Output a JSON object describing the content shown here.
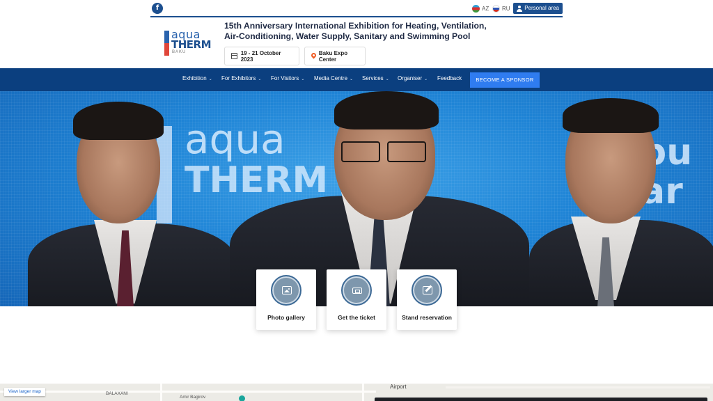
{
  "topbar": {
    "facebook_icon": "facebook-icon",
    "languages": [
      {
        "code": "AZ",
        "flag": "az-flag-icon"
      },
      {
        "code": "RU",
        "flag": "ru-flag-icon"
      }
    ],
    "personal_area_label": "Personal area"
  },
  "header": {
    "logo": {
      "line1": "aqua",
      "line2": "THERM",
      "line3": "BAKU"
    },
    "title_line1": "15th Anniversary International Exhibition for Heating, Ventilation,",
    "title_line2": "Air-Conditioning, Water Supply, Sanitary and Swimming Pool",
    "dates": "19 - 21 October 2023",
    "venue": "Baku Expo Center"
  },
  "nav": {
    "items": [
      {
        "label": "Exhibition",
        "caret": "⌄"
      },
      {
        "label": "For Exhibitors",
        "caret": "⌄"
      },
      {
        "label": "For Visitors",
        "caret": "⌄"
      },
      {
        "label": "Media Centre",
        "caret": "⌄"
      },
      {
        "label": "Services",
        "caret": "⌄"
      },
      {
        "label": "Organiser",
        "caret": "⌄"
      },
      {
        "label": "Feedback",
        "caret": ""
      }
    ],
    "sponsor_button": "BECOME A SPONSOR"
  },
  "hero": {
    "backdrop_text_1": "aqua",
    "backdrop_text_2": "THERM",
    "backdrop_text_right": "bu\nar"
  },
  "cards": [
    {
      "label": "Photo gallery",
      "icon": "image-icon"
    },
    {
      "label": "Get the ticket",
      "icon": "ticket-icon"
    },
    {
      "label": "Stand reservation",
      "icon": "edit-icon"
    }
  ],
  "map": {
    "view_larger_label": "View larger map",
    "labels": [
      "BALAXANI",
      "Amir Bagirov",
      "Airport"
    ]
  },
  "colors": {
    "brand_blue": "#0b3f7f",
    "accent_blue": "#2f7cf0",
    "logo_red": "#e0463a"
  }
}
